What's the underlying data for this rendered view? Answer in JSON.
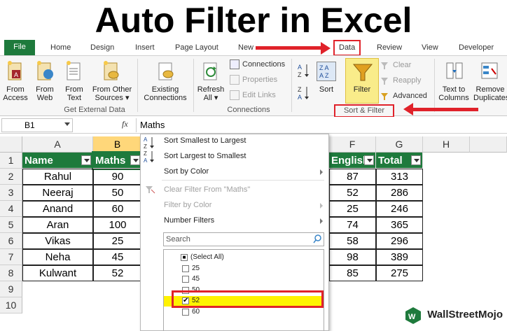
{
  "page_title": "Auto Filter in Excel",
  "tabs": [
    "File",
    "Home",
    "Design",
    "Insert",
    "Page Layout",
    "New",
    "Data",
    "Review",
    "View",
    "Developer"
  ],
  "ribbon": {
    "get_external": {
      "buttons": [
        "From\nAccess",
        "From\nWeb",
        "From\nText",
        "From Other\nSources ▾"
      ],
      "label": "Get External Data"
    },
    "existing": "Existing\nConnections",
    "connections": {
      "refresh": "Refresh\nAll ▾",
      "items": [
        "Connections",
        "Properties",
        "Edit Links"
      ],
      "label": "Connections"
    },
    "sortfilter": {
      "sort": "Sort",
      "filter": "Filter",
      "items": [
        "Clear",
        "Reapply",
        "Advanced"
      ],
      "label": "Sort & Filter"
    },
    "text_to_columns": "Text to\nColumns",
    "remove_duplicates": "Remove\nDuplicates"
  },
  "formula_bar": {
    "cell": "B1",
    "fx": "fx",
    "value": "Maths"
  },
  "columns": [
    "A",
    "B",
    "F",
    "G",
    "H"
  ],
  "rows": [
    "1",
    "2",
    "3",
    "4",
    "5",
    "6",
    "7",
    "8",
    "9",
    "10"
  ],
  "headers": {
    "name": "Name",
    "maths": "Maths",
    "english": "English",
    "total": "Total"
  },
  "data": [
    {
      "name": "Rahul",
      "maths": "90",
      "english": "87",
      "total": "313"
    },
    {
      "name": "Neeraj",
      "maths": "50",
      "english": "52",
      "total": "286"
    },
    {
      "name": "Anand",
      "maths": "60",
      "english": "25",
      "total": "246"
    },
    {
      "name": "Aran",
      "maths": "100",
      "english": "74",
      "total": "365"
    },
    {
      "name": "Vikas",
      "maths": "25",
      "english": "58",
      "total": "296"
    },
    {
      "name": "Neha",
      "maths": "45",
      "english": "98",
      "total": "389"
    },
    {
      "name": "Kulwant",
      "maths": "52",
      "english": "85",
      "total": "275"
    }
  ],
  "menu": {
    "sort_asc": "Sort Smallest to Largest",
    "sort_desc": "Sort Largest to Smallest",
    "sort_color": "Sort by Color",
    "clear_filter": "Clear Filter From \"Maths\"",
    "filter_color": "Filter by Color",
    "number_filters": "Number Filters",
    "search_placeholder": "Search",
    "items": [
      "(Select All)",
      "25",
      "45",
      "50",
      "52",
      "60"
    ]
  },
  "branding": "WallStreetMojo",
  "colors": {
    "excel_green": "#1e7a3c",
    "highlight": "#ffd77a",
    "callout_red": "#e0222a"
  }
}
